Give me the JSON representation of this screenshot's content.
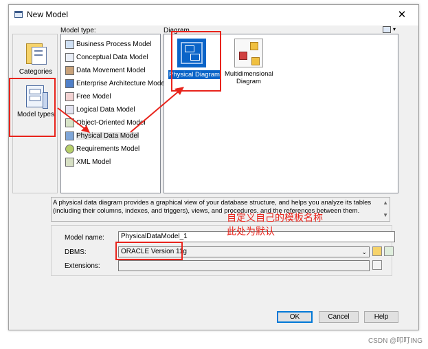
{
  "window": {
    "title": "New Model",
    "close": "✕"
  },
  "model_type_label": "Model type:",
  "diagram_label": "Diagram",
  "categories": [
    {
      "label": "Categories"
    },
    {
      "label": "Model types"
    }
  ],
  "model_types": [
    {
      "label": "Business Process Model"
    },
    {
      "label": "Conceptual Data Model"
    },
    {
      "label": "Data Movement Model"
    },
    {
      "label": "Enterprise Architecture Model"
    },
    {
      "label": "Free Model"
    },
    {
      "label": "Logical Data Model"
    },
    {
      "label": "Object-Oriented Model"
    },
    {
      "label": "Physical Data Model"
    },
    {
      "label": "Requirements Model"
    },
    {
      "label": "XML Model"
    }
  ],
  "diagrams": [
    {
      "label": "Physical Diagram"
    },
    {
      "label": "Multidimensional Diagram"
    }
  ],
  "description": "A physical data diagram provides a graphical view of your database structure, and helps you analyze its tables (including their columns, indexes, and triggers), views, and procedures, and the references between them.",
  "form": {
    "model_name_label": "Model name:",
    "model_name_value": "PhysicalDataModel_1",
    "dbms_label": "DBMS:",
    "dbms_value": "ORACLE Version 11g",
    "extensions_label": "Extensions:",
    "extensions_value": ""
  },
  "buttons": {
    "ok": "OK",
    "cancel": "Cancel",
    "help": "Help"
  },
  "annotations": {
    "line1": "自定义自己的模板名称",
    "line2": "此处为默认"
  },
  "watermark": "CSDN @叩叮ING",
  "colors": {
    "annotation_red": "#e8231b",
    "selected_blue": "#0a64c8",
    "default_button": "#0078d7"
  }
}
